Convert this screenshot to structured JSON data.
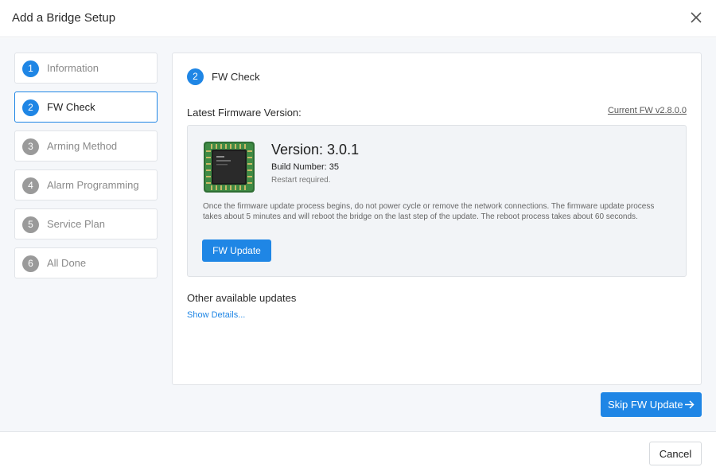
{
  "dialog": {
    "title": "Add a Bridge Setup",
    "close_icon": "close-icon"
  },
  "steps": [
    {
      "num": "1",
      "label": "Information",
      "state": "done"
    },
    {
      "num": "2",
      "label": "FW Check",
      "state": "active"
    },
    {
      "num": "3",
      "label": "Arming Method",
      "state": "pending"
    },
    {
      "num": "4",
      "label": "Alarm Programming",
      "state": "pending"
    },
    {
      "num": "5",
      "label": "Service Plan",
      "state": "pending"
    },
    {
      "num": "6",
      "label": "All Done",
      "state": "pending"
    }
  ],
  "panel": {
    "num": "2",
    "title": "FW Check",
    "latest_label": "Latest Firmware Version:",
    "current_fw": "Current FW v2.8.0.0",
    "firmware": {
      "chip_icon": "firmware-chip-icon",
      "version": "Version: 3.0.1",
      "build": "Build Number: 35",
      "restart": "Restart required.",
      "warning": "Once the firmware update process begins, do not power cycle or remove the network connections. The firmware update process takes about 5 minutes and will reboot the bridge on the last step of the update. The reboot process takes about 60 seconds.",
      "update_label": "FW Update"
    },
    "other_label": "Other available updates",
    "show_details": "Show Details..."
  },
  "actions": {
    "skip_label": "Skip FW Update",
    "skip_icon": "arrow-right-icon",
    "cancel_label": "Cancel"
  },
  "colors": {
    "accent": "#1f86e5",
    "inactive_step": "#9a9a9a",
    "background": "#f5f7fa"
  }
}
